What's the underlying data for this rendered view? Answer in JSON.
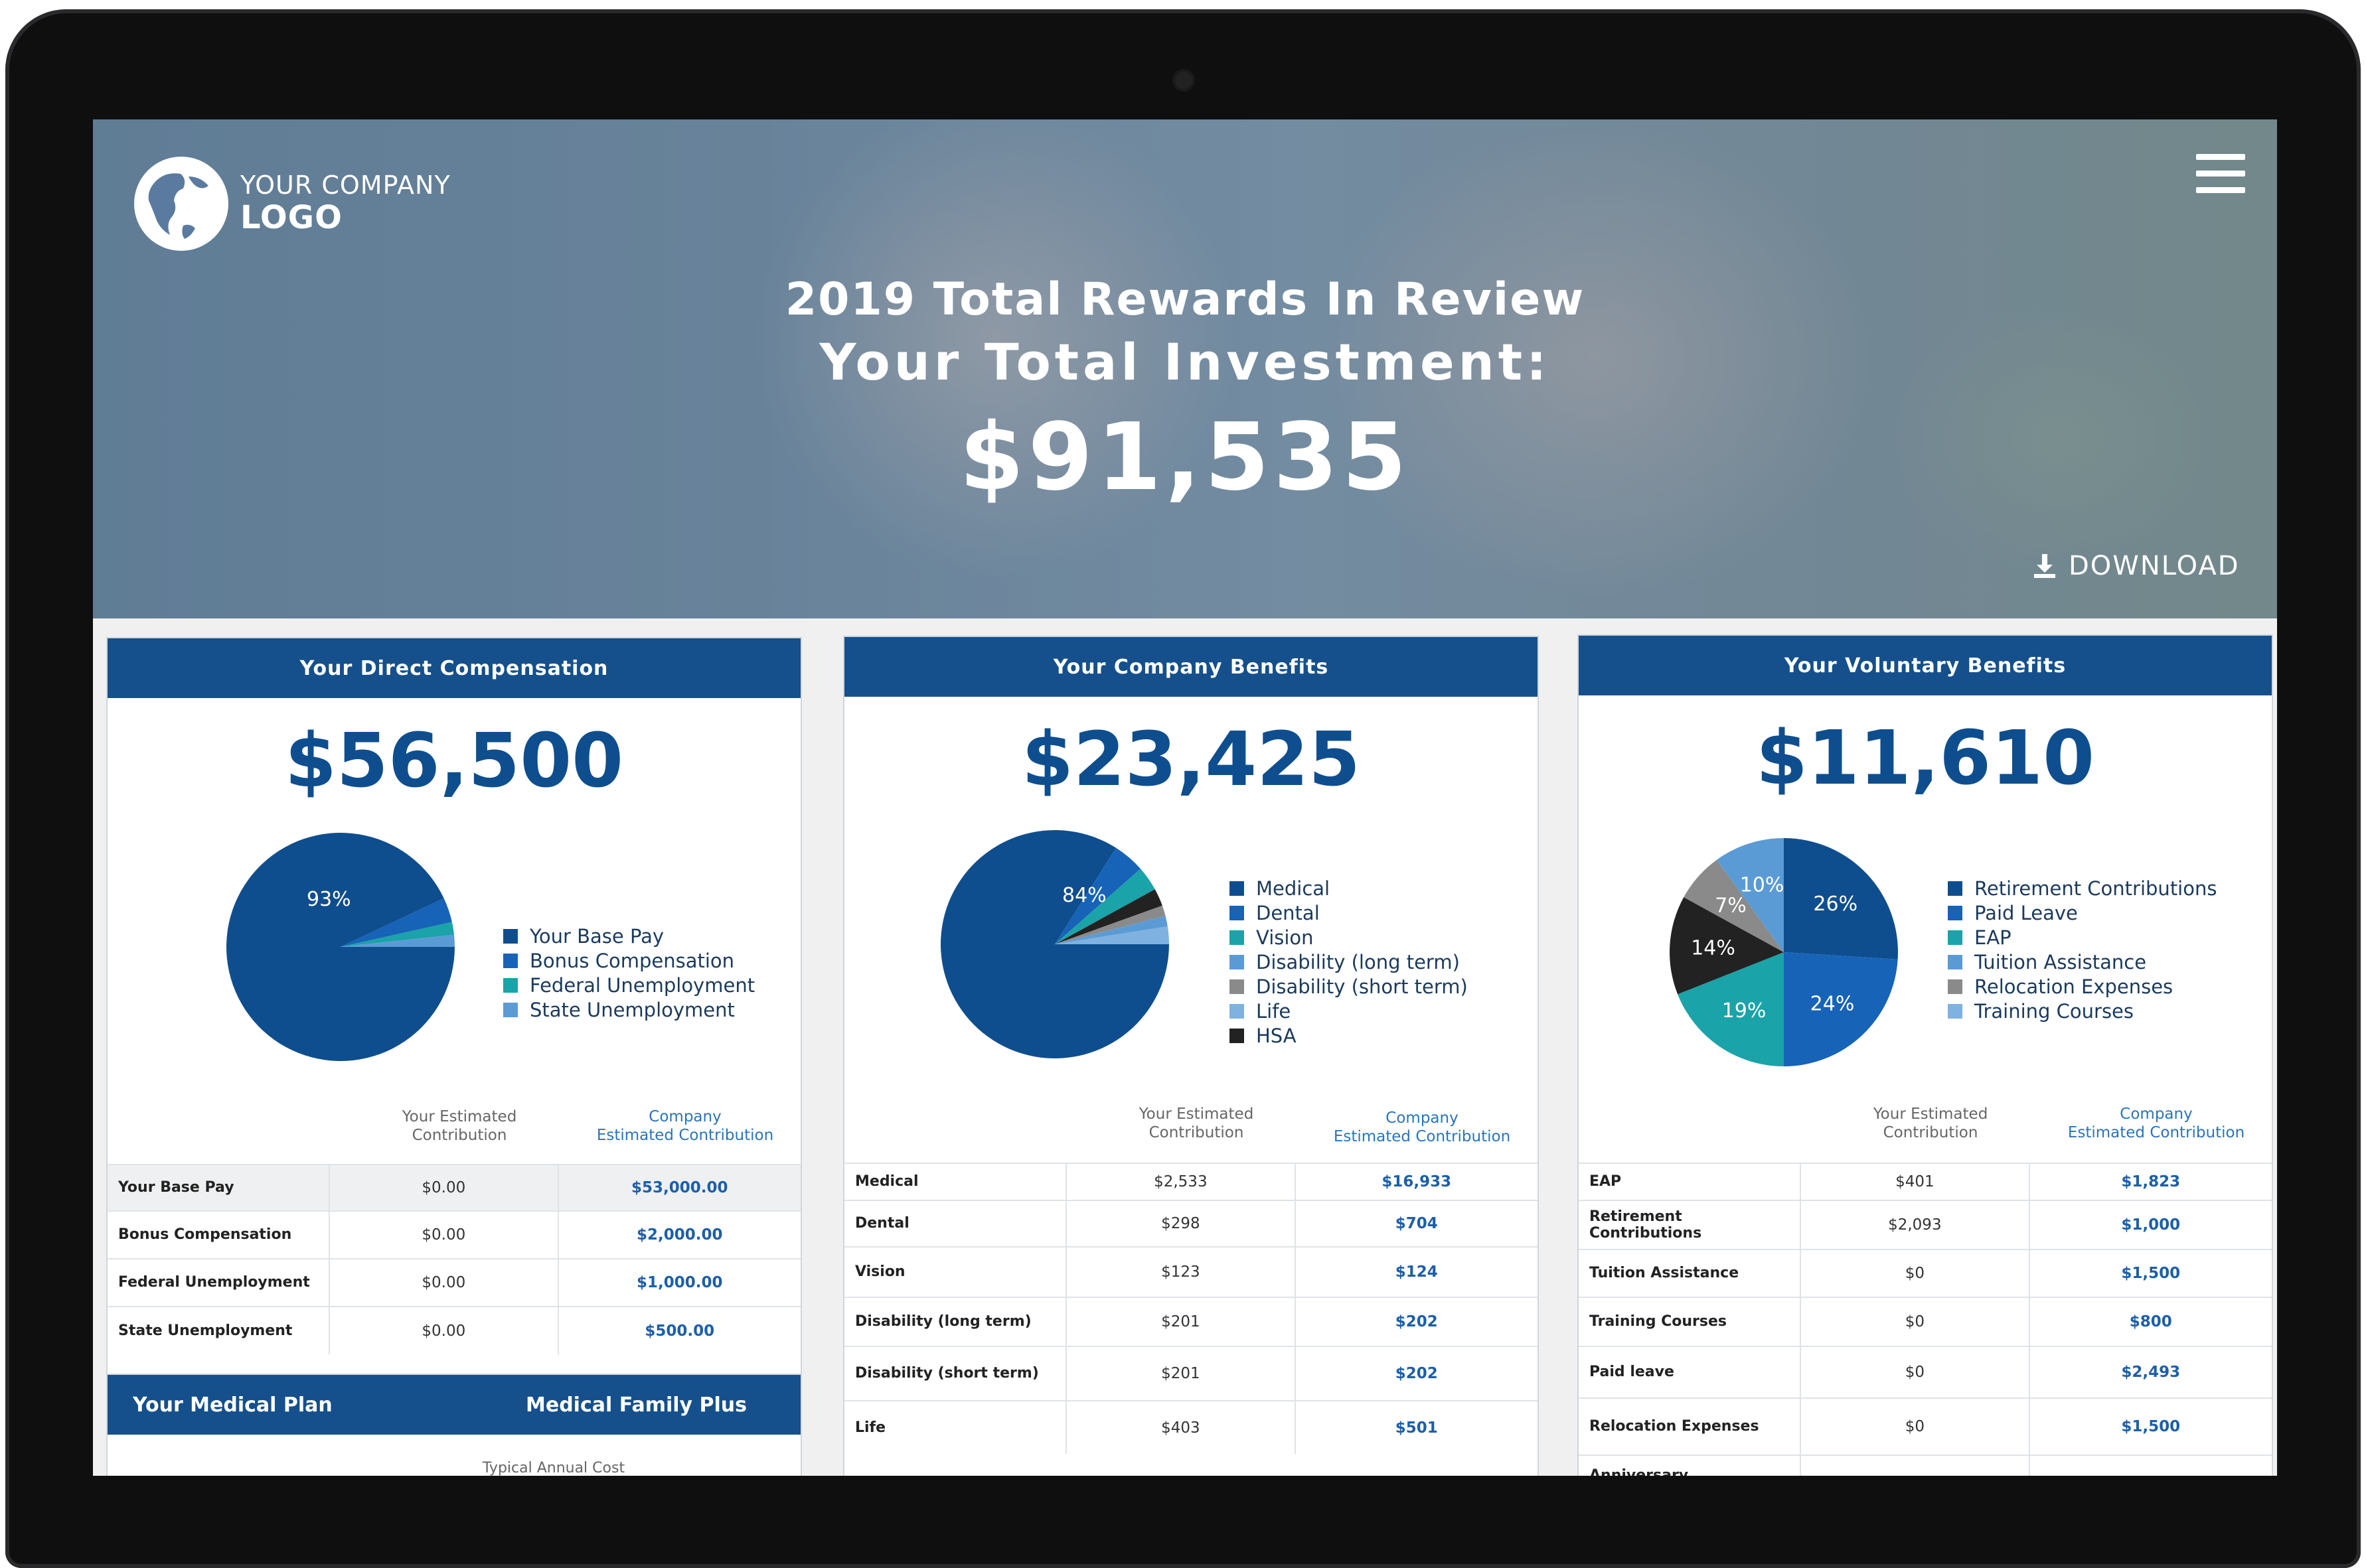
{
  "header": {
    "logo_line1": "YOUR COMPANY",
    "logo_line2": "LOGO",
    "title_line1": "2019 Total Rewards In Review",
    "title_line2": "Your Total Investment:",
    "total": "$91,535",
    "download_label": "DOWNLOAD"
  },
  "colors": {
    "brand_blue": "#15508c",
    "total_blue": "#0f4e8e",
    "link_blue": "#1d5fa8"
  },
  "icons": {
    "logo": "globe-icon",
    "menu": "hamburger-menu-icon",
    "download": "download-icon"
  },
  "columns": {
    "you_line1": "Your Estimated",
    "you_line2": "Contribution",
    "company_line1": "Company",
    "company_line2": "Estimated Contribution"
  },
  "direct": {
    "title": "Your Direct Compensation",
    "total": "$56,500",
    "pie_label": "93%",
    "legend": [
      {
        "label": "Your Base Pay",
        "color": "#0f4e8e"
      },
      {
        "label": "Bonus Compensation",
        "color": "#1763b8"
      },
      {
        "label": "Federal Unemployment",
        "color": "#1aa3a8"
      },
      {
        "label": "State Unemployment",
        "color": "#5b9bd5"
      }
    ],
    "slices": [
      {
        "value": 93,
        "color": "#0f4e8e"
      },
      {
        "value": 3.5,
        "color": "#1763b8"
      },
      {
        "value": 1.8,
        "color": "#1aa3a8"
      },
      {
        "value": 1.7,
        "color": "#5b9bd5"
      }
    ],
    "rows": [
      {
        "label": "Your Base Pay",
        "you": "$0.00",
        "company": "$53,000.00"
      },
      {
        "label": "Bonus Compensation",
        "you": "$0.00",
        "company": "$2,000.00"
      },
      {
        "label": "Federal Unemployment",
        "you": "$0.00",
        "company": "$1,000.00"
      },
      {
        "label": "State Unemployment",
        "you": "$0.00",
        "company": "$500.00"
      }
    ]
  },
  "medical": {
    "title": "Your Medical Plan",
    "plan": "Medical Family Plus",
    "sub": "Typical Annual Cost"
  },
  "company": {
    "title": "Your Company Benefits",
    "total": "$23,425",
    "pie_label": "84%",
    "legend": [
      {
        "label": "Medical",
        "color": "#0f4e8e"
      },
      {
        "label": "Dental",
        "color": "#1763b8"
      },
      {
        "label": "Vision",
        "color": "#1aa3a8"
      },
      {
        "label": "Disability (long term)",
        "color": "#5b9bd5"
      },
      {
        "label": "Disability (short term)",
        "color": "#8a8a8a"
      },
      {
        "label": "Life",
        "color": "#7fb2e0"
      },
      {
        "label": "HSA",
        "color": "#222222"
      }
    ],
    "slices": [
      {
        "value": 84,
        "color": "#0f4e8e"
      },
      {
        "value": 4.5,
        "color": "#1763b8"
      },
      {
        "value": 3.5,
        "color": "#1aa3a8"
      },
      {
        "value": 2.5,
        "color": "#222222"
      },
      {
        "value": 1.5,
        "color": "#8a8a8a"
      },
      {
        "value": 1.5,
        "color": "#5b9bd5"
      },
      {
        "value": 2.5,
        "color": "#7fb2e0"
      }
    ],
    "rows": [
      {
        "label": "Medical",
        "you": "$2,533",
        "company": "$16,933"
      },
      {
        "label": "Dental",
        "you": "$298",
        "company": "$704"
      },
      {
        "label": "Vision",
        "you": "$123",
        "company": "$124"
      },
      {
        "label": "Disability (long term)",
        "you": "$201",
        "company": "$202"
      },
      {
        "label": "Disability (short term)",
        "you": "$201",
        "company": "$202"
      },
      {
        "label": "Life",
        "you": "$403",
        "company": "$501"
      }
    ]
  },
  "voluntary": {
    "title": "Your Voluntary Benefits",
    "total": "$11,610",
    "legend": [
      {
        "label": "Retirement Contributions",
        "color": "#0f4e8e"
      },
      {
        "label": "Paid Leave",
        "color": "#1763b8"
      },
      {
        "label": "EAP",
        "color": "#1aa3a8"
      },
      {
        "label": "Tuition Assistance",
        "color": "#5b9bd5"
      },
      {
        "label": "Relocation Expenses",
        "color": "#8a8a8a"
      },
      {
        "label": "Training Courses",
        "color": "#7fb2e0"
      }
    ],
    "slices": [
      {
        "value": 26,
        "color": "#0f4e8e",
        "label": "26%"
      },
      {
        "value": 24,
        "color": "#1763b8",
        "label": "24%"
      },
      {
        "value": 19,
        "color": "#1aa3a8",
        "label": "19%"
      },
      {
        "value": 14,
        "color": "#222222",
        "label": "14%"
      },
      {
        "value": 7,
        "color": "#8a8a8a",
        "label": "7%"
      },
      {
        "value": 10,
        "color": "#5b9bd5",
        "label": "10%"
      }
    ],
    "rows": [
      {
        "label": "EAP",
        "you": "$401",
        "company": "$1,823"
      },
      {
        "label": "Retirement Contributions",
        "you": "$2,093",
        "company": "$1,000"
      },
      {
        "label": "Tuition Assistance",
        "you": "$0",
        "company": "$1,500"
      },
      {
        "label": "Training Courses",
        "you": "$0",
        "company": "$800"
      },
      {
        "label": "Paid leave",
        "you": "$0",
        "company": "$2,493"
      },
      {
        "label": "Relocation Expenses",
        "you": "$0",
        "company": "$1,500"
      },
      {
        "label": "Anniversary",
        "you": "",
        "company": ""
      }
    ]
  }
}
